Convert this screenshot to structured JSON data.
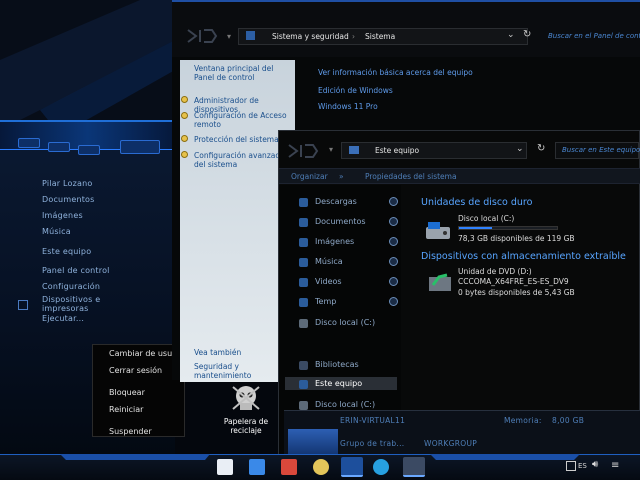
{
  "start_menu": {
    "items": [
      "Pilar Lozano",
      "Documentos",
      "Imágenes",
      "Música",
      "Este equipo",
      "Panel de control",
      "Configuración",
      "Dispositivos e impresoras",
      "Ejecutar..."
    ]
  },
  "context_menu": {
    "items": [
      "Cambiar de usuario",
      "Cerrar sesión",
      "Bloquear",
      "Reiniciar",
      "Suspender"
    ]
  },
  "system_window": {
    "breadcrumb": [
      "Sistema y seguridad",
      "Sistema"
    ],
    "search_placeholder": "Buscar en el Panel de contr...",
    "sidebar": {
      "home_link": "Ventana principal del Panel de control",
      "links": [
        "Administrador de dispositivos",
        "Configuración de Acceso remoto",
        "Protección del sistema",
        "Configuración avanzada del sistema"
      ],
      "see_also": "Vea también",
      "security": "Seguridad y mantenimiento"
    },
    "main": {
      "heading": "Ver información básica acerca del equipo",
      "edition_label": "Edición de Windows",
      "edition": "Windows 11 Pro"
    }
  },
  "explorer_window": {
    "location": "Este equipo",
    "search_placeholder": "Buscar en Este equipo",
    "toolbar": [
      "Organizar",
      "Propiedades del sistema"
    ],
    "nav": [
      "Descargas",
      "Documentos",
      "Imágenes",
      "Música",
      "Videos",
      "Temp",
      "Disco local (C:)",
      "Bibliotecas",
      "Este equipo",
      "Disco local (C:)"
    ],
    "hard_drives_title": "Unidades de disco duro",
    "local_disk": {
      "name": "Disco local (C:)",
      "free": "78,3 GB disponibles de 119 GB",
      "used_fraction": 0.34
    },
    "removable_title": "Dispositivos con almacenamiento extraíble",
    "dvd": {
      "name": "Unidad de DVD (D:)",
      "label": "CCCOMA_X64FRE_ES-ES_DV9",
      "free": "0 bytes disponibles de 5,43 GB"
    },
    "details": {
      "computer": "ERIN-VIRTUAL11",
      "memory_label": "Memoria:",
      "memory": "8,00 GB",
      "workgroup_label": "Grupo de trab...",
      "workgroup": "WORKGROUP"
    }
  },
  "desktop": {
    "recycle_bin": "Papelera de reciclaje"
  },
  "taskbar": {
    "tray_language": "ES"
  },
  "colors": {
    "accent": "#2f82ff",
    "link": "#5f9bea",
    "section_title": "#58a5ff"
  }
}
